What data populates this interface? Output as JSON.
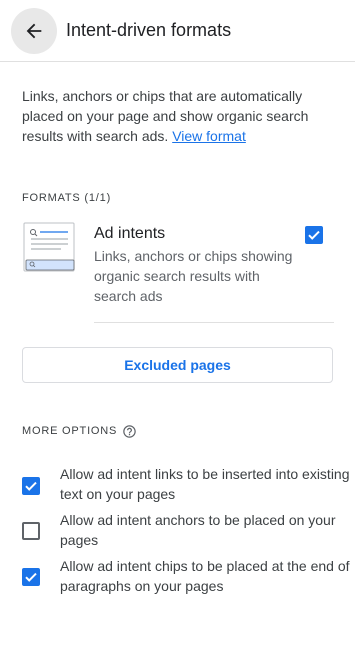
{
  "header": {
    "title": "Intent-driven formats",
    "back_icon": "arrow-back-icon"
  },
  "description": {
    "text": "Links, anchors or chips that are automatically placed on your page and show organic search results with search ads.",
    "link_label": "View format"
  },
  "formats": {
    "section_label": "FORMATS (1/1)",
    "items": [
      {
        "title": "Ad intents",
        "description": "Links, anchors or chips showing organic search results with search ads",
        "checked": true
      }
    ]
  },
  "excluded_pages_label": "Excluded pages",
  "more_options": {
    "section_label": "MORE OPTIONS",
    "help_icon": "help-circle-icon",
    "options": [
      {
        "label": "Allow ad intent links to be inserted into existing text on your pages",
        "checked": true
      },
      {
        "label": "Allow ad intent anchors to be placed on your pages",
        "checked": false
      },
      {
        "label": "Allow ad intent chips to be placed at the end of paragraphs on your pages",
        "checked": true
      }
    ]
  },
  "colors": {
    "accent": "#1a73e8",
    "text": "#3c4043",
    "border": "#dadce0"
  }
}
